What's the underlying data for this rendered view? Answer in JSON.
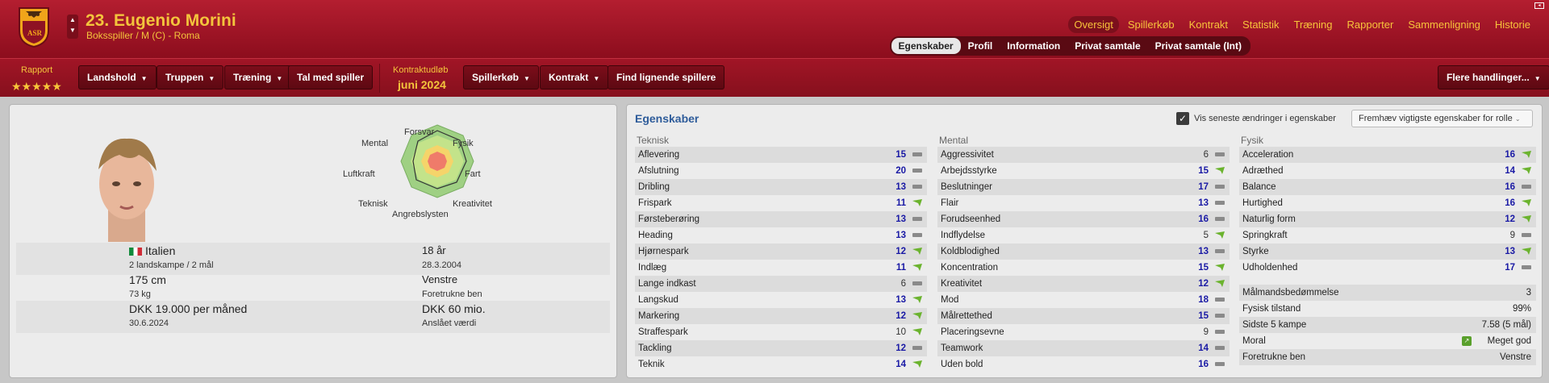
{
  "header": {
    "player_name": "23. Eugenio Morini",
    "player_sub": "Boksspiller / M (C) - Roma",
    "main_nav": [
      "Oversigt",
      "Spillerkøb",
      "Kontrakt",
      "Statistik",
      "Træning",
      "Rapporter",
      "Sammenligning",
      "Historie"
    ],
    "sub_tabs": [
      "Egenskaber",
      "Profil",
      "Information",
      "Privat samtale",
      "Privat samtale (Int)"
    ],
    "colors": {
      "bar": "#a51a2b",
      "accent": "#f3c43c"
    }
  },
  "toolbar": {
    "rapport_label": "Rapport",
    "stars": "★★★★★",
    "landshold": "Landshold",
    "truppen": "Truppen",
    "traening": "Træning",
    "tal_med": "Tal med spiller",
    "kontrakt_label": "Kontraktudløb",
    "kontrakt_value": "juni 2024",
    "spillerkob": "Spillerkøb",
    "kontrakt": "Kontrakt",
    "find": "Find lignende spillere",
    "flere": "Flere handlinger..."
  },
  "profile": {
    "radar_labels": [
      "Forsvar",
      "Fysik",
      "Fart",
      "Kreativitet",
      "Angrebslysten",
      "Teknisk",
      "Luftkraft",
      "Mental"
    ],
    "nationality": "Italien",
    "caps": "2 landskampe / 2 mål",
    "age": "18 år",
    "dob": "28.3.2004",
    "height": "175 cm",
    "weight": "73 kg",
    "foot": "Venstre",
    "foot_label": "Foretrukne ben",
    "wage": "DKK 19.000 per måned",
    "wage_until": "30.6.2024",
    "value": "DKK 60 mio.",
    "value_label": "Anslået værdi"
  },
  "attributes": {
    "title": "Egenskaber",
    "show_changes": "Vis seneste ændringer i egenskaber",
    "highlight_dropdown": "Fremhæv vigtigste egenskaber for rolle",
    "teknisk_head": "Teknisk",
    "mental_head": "Mental",
    "fysik_head": "Fysik",
    "teknisk": [
      {
        "name": "Aflevering",
        "value": "15",
        "trend": "dash"
      },
      {
        "name": "Afslutning",
        "value": "20",
        "trend": "dash"
      },
      {
        "name": "Dribling",
        "value": "13",
        "trend": "dash"
      },
      {
        "name": "Frispark",
        "value": "11",
        "trend": "up"
      },
      {
        "name": "Førsteberøring",
        "value": "13",
        "trend": "dash"
      },
      {
        "name": "Heading",
        "value": "13",
        "trend": "dash"
      },
      {
        "name": "Hjørnespark",
        "value": "12",
        "trend": "up"
      },
      {
        "name": "Indlæg",
        "value": "11",
        "trend": "up"
      },
      {
        "name": "Lange indkast",
        "value": "6",
        "trend": "dash"
      },
      {
        "name": "Langskud",
        "value": "13",
        "trend": "up"
      },
      {
        "name": "Markering",
        "value": "12",
        "trend": "up"
      },
      {
        "name": "Straffespark",
        "value": "10",
        "trend": "up"
      },
      {
        "name": "Tackling",
        "value": "12",
        "trend": "dash"
      },
      {
        "name": "Teknik",
        "value": "14",
        "trend": "up"
      }
    ],
    "mental": [
      {
        "name": "Aggressivitet",
        "value": "6",
        "trend": "dash"
      },
      {
        "name": "Arbejdsstyrke",
        "value": "15",
        "trend": "up"
      },
      {
        "name": "Beslutninger",
        "value": "17",
        "trend": "dash"
      },
      {
        "name": "Flair",
        "value": "13",
        "trend": "dash"
      },
      {
        "name": "Forudseenhed",
        "value": "16",
        "trend": "dash"
      },
      {
        "name": "Indflydelse",
        "value": "5",
        "trend": "up"
      },
      {
        "name": "Koldblodighed",
        "value": "13",
        "trend": "dash"
      },
      {
        "name": "Koncentration",
        "value": "15",
        "trend": "up"
      },
      {
        "name": "Kreativitet",
        "value": "12",
        "trend": "up"
      },
      {
        "name": "Mod",
        "value": "18",
        "trend": "dash"
      },
      {
        "name": "Målrettethed",
        "value": "15",
        "trend": "dash"
      },
      {
        "name": "Placeringsevne",
        "value": "9",
        "trend": "dash"
      },
      {
        "name": "Teamwork",
        "value": "14",
        "trend": "dash"
      },
      {
        "name": "Uden bold",
        "value": "16",
        "trend": "dash"
      }
    ],
    "fysik": [
      {
        "name": "Acceleration",
        "value": "16",
        "trend": "up"
      },
      {
        "name": "Adræthed",
        "value": "14",
        "trend": "up"
      },
      {
        "name": "Balance",
        "value": "16",
        "trend": "dash"
      },
      {
        "name": "Hurtighed",
        "value": "16",
        "trend": "up"
      },
      {
        "name": "Naturlig form",
        "value": "12",
        "trend": "up"
      },
      {
        "name": "Springkraft",
        "value": "9",
        "trend": "dash"
      },
      {
        "name": "Styrke",
        "value": "13",
        "trend": "up"
      },
      {
        "name": "Udholdenhed",
        "value": "17",
        "trend": "dash"
      }
    ],
    "stats": [
      {
        "label": "Målmandsbedømmelse",
        "value": "3"
      },
      {
        "label": "Fysisk tilstand",
        "value": "99%"
      },
      {
        "label": "Sidste 5 kampe",
        "value": "7.58 (5 mål)"
      },
      {
        "label": "Moral",
        "value": "Meget god"
      },
      {
        "label": "Foretrukne ben",
        "value": "Venstre"
      }
    ]
  }
}
